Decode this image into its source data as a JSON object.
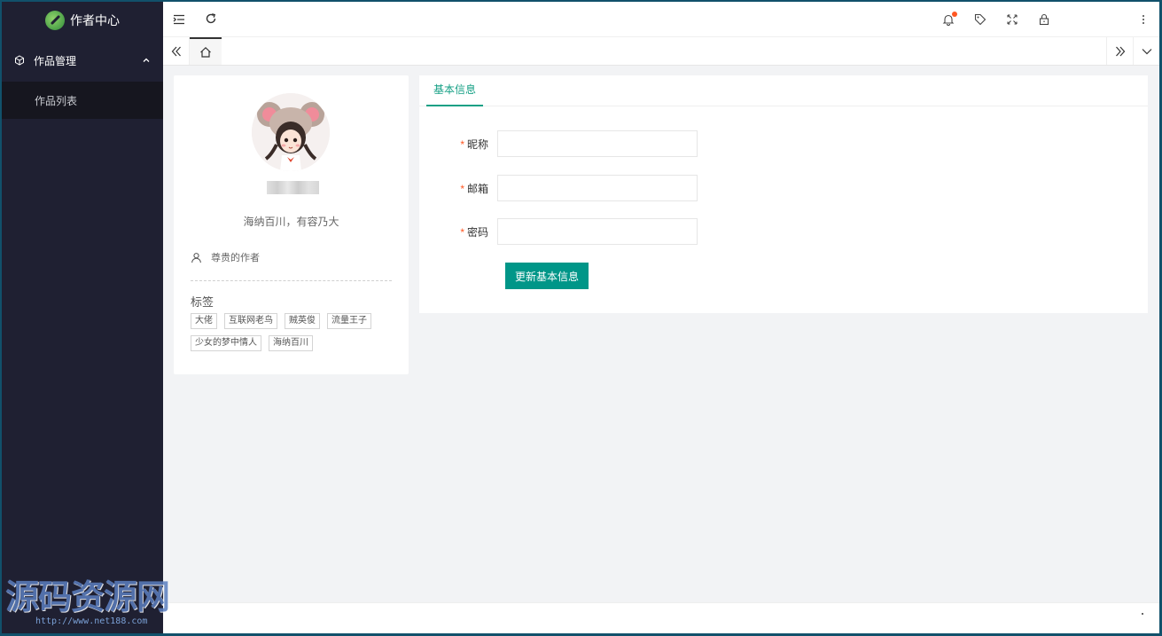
{
  "sidebar": {
    "logo_text": "作者中心",
    "menu": {
      "group_label": "作品管理",
      "items": [
        {
          "label": "作品列表"
        }
      ]
    }
  },
  "header": {
    "icons": [
      "menu-fold-icon",
      "refresh-icon",
      "bell-icon",
      "tag-icon",
      "fullscreen-icon",
      "lock-icon",
      "more-vertical-icon"
    ],
    "notification_dot": true
  },
  "tabbar": {
    "icons": [
      "double-left-icon",
      "home-icon",
      "double-right-icon",
      "chevron-down-icon"
    ]
  },
  "profile": {
    "motto": "海纳百川，有容乃大",
    "role": "尊贵的作者",
    "tags_title": "标签",
    "tags": [
      "大佬",
      "互联网老鸟",
      "贼英俊",
      "流量王子",
      "少女的梦中情人",
      "海纳百川"
    ]
  },
  "form": {
    "tab_label": "基本信息",
    "fields": [
      {
        "label": "昵称",
        "value": ""
      },
      {
        "label": "邮箱",
        "value": ""
      },
      {
        "label": "密码",
        "value": ""
      }
    ],
    "required_mark": "*",
    "submit_label": "更新基本信息"
  },
  "watermark": {
    "text": "源码资源网",
    "url": "http://www.net188.com"
  },
  "colors": {
    "sidebar_bg": "#1f2032",
    "sidebar_sub_bg": "#16161f",
    "accent": "#009688",
    "tab_accent": "#16a085",
    "required": "#ff5722",
    "page_bg": "#f2f3f5"
  }
}
